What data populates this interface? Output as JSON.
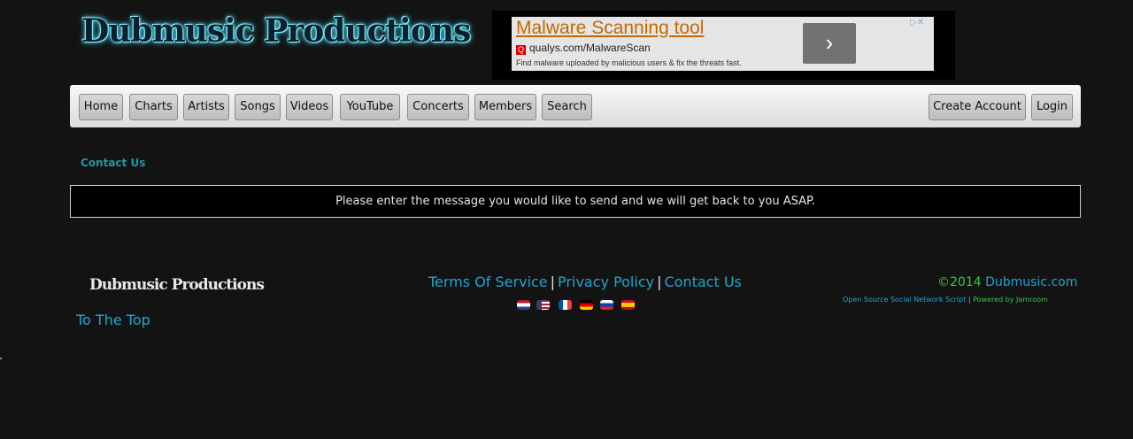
{
  "header": {
    "logo_text": "Dubmusic Productions"
  },
  "ad": {
    "title": "Malware Scanning tool",
    "url": "qualys.com/MalwareScan",
    "description": "Find malware uploaded by malicious users & fix the threats fast.",
    "url_icon": "Q",
    "next_icon": "›",
    "choices_icon": "▷✕"
  },
  "nav": {
    "items": [
      "Home",
      "Charts",
      "Artists",
      "Songs",
      "Videos",
      "YouTube",
      "Concerts",
      "Members",
      "Search"
    ],
    "right_items": [
      "Create Account",
      "Login"
    ]
  },
  "page": {
    "title": "Contact Us",
    "message": "Please enter the message you would like to send and we will get back to you ASAP."
  },
  "footer": {
    "logo_text": "Dubmusic Productions",
    "to_top": "To The Top",
    "links": [
      "Terms Of Service",
      "Privacy Policy",
      "Contact Us"
    ],
    "separator": "|",
    "copyright_year": "©2014",
    "copyright_site": "Dubmusic.com",
    "powered_left": "Open Source Social Network Script",
    "powered_sep": "|",
    "powered_right": "Powered by Jamroom",
    "flags": [
      "netherlands-flag-icon",
      "usa-flag-icon",
      "france-flag-icon",
      "germany-flag-icon",
      "slovenia-flag-icon",
      "spain-flag-icon"
    ]
  },
  "colors": {
    "background": "#131313",
    "accent_teal": "#1a9aa8",
    "link_blue": "#1ea6d0",
    "green": "#2ecc40"
  }
}
